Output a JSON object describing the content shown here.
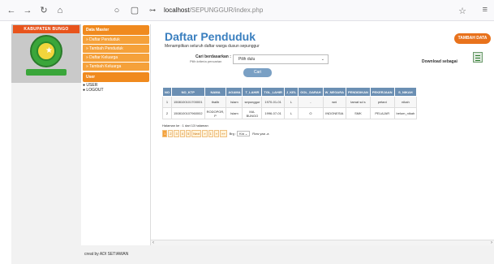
{
  "browser": {
    "url_host": "localhost",
    "url_path": "/SEPUNGGUR/index.php"
  },
  "sidebar": {
    "kabupaten_text": "KABUPATEN BUNGO",
    "data_master_label": "Data Master",
    "items": [
      {
        "label": "» Daftar Penduduk"
      },
      {
        "label": "» Tambah Penduduk"
      },
      {
        "label": "» Daftar Keluarga"
      },
      {
        "label": "» Tambah Keluarga"
      }
    ],
    "user_label": "User",
    "user_links": [
      {
        "label": "USER"
      },
      {
        "label": "LOGOUT"
      }
    ]
  },
  "main": {
    "title": "Daftar Penduduk",
    "subtitle": "Menampilkan seluruh daftar warga dusun sepunggur",
    "add_button": "TAMBAH DATA",
    "search_label": "Cari berdasarkan :",
    "search_hint": "Pilih kriteria pencarian",
    "search_value": "Pilih dulu",
    "search_button": "Cari",
    "download_label": "Download sebagai",
    "table": {
      "headers": [
        "NO",
        "NO_KTP",
        "NAMA",
        "AGAMA",
        "T_LAHIR",
        "TGL_LAHIR",
        "J_KEL",
        "GOL_DARAH",
        "W_NEGARA",
        "PENDIDIKAN",
        "PEKERJAAN",
        "S_NIKAH"
      ],
      "rows": [
        [
          "1",
          "1508100101700001",
          "thalib",
          "Islam",
          "sepunggur",
          "1970-01-01",
          "L",
          "-",
          "wni",
          "tamat sd s",
          "petani",
          "nikah"
        ],
        [
          "2",
          "1508100107960002",
          "RODOPOR, P",
          "Islam",
          "MA. BUNGO",
          "1996-07-01",
          "L",
          "O",
          "INDONESIA",
          "SMK",
          "PELAJAR",
          "belum_nikah"
        ]
      ]
    },
    "page_info": "Halaman ke : 1 dari 13 halaman",
    "pager": {
      "buttons": [
        "1",
        "2",
        "3",
        "4",
        "5",
        "Next",
        "»",
        "1",
        "»",
        "»»"
      ],
      "brg_label": "Brg :",
      "brg_value": "Kia",
      "row_label": "Row yaa ‑a"
    }
  },
  "footer": {
    "text": "creat by ADI SETIAWAN"
  }
}
